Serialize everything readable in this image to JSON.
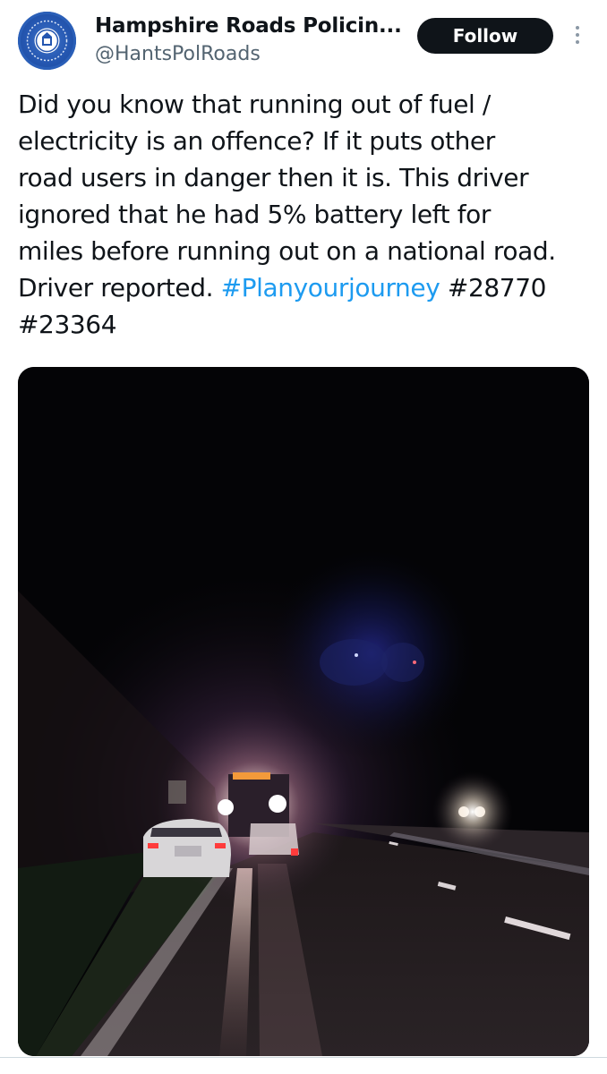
{
  "account": {
    "display_name": "Hampshire Roads Policin...",
    "handle": "@HantsPolRoads",
    "avatar_icon": "police-crest-icon"
  },
  "actions": {
    "follow_label": "Follow",
    "more_icon": "more-options-icon"
  },
  "tweet": {
    "lines": [
      "Did you know that running out of fuel /",
      "electricity is an offence? If it puts other",
      "road users in danger then it is. This driver",
      "ignored that he had 5% battery left for",
      "miles before running out on a national road."
    ],
    "line6_text": "Driver reported. ",
    "hashtag1": "#Planyourjourney",
    "hashtag2": "#28770",
    "hashtag3": "#23364"
  },
  "media": {
    "type": "photo",
    "description_icon": "night-road-recovery-photo"
  },
  "colors": {
    "hashtag": "#1d9bf0",
    "follow_bg": "#0f1419",
    "handle": "#536471"
  }
}
